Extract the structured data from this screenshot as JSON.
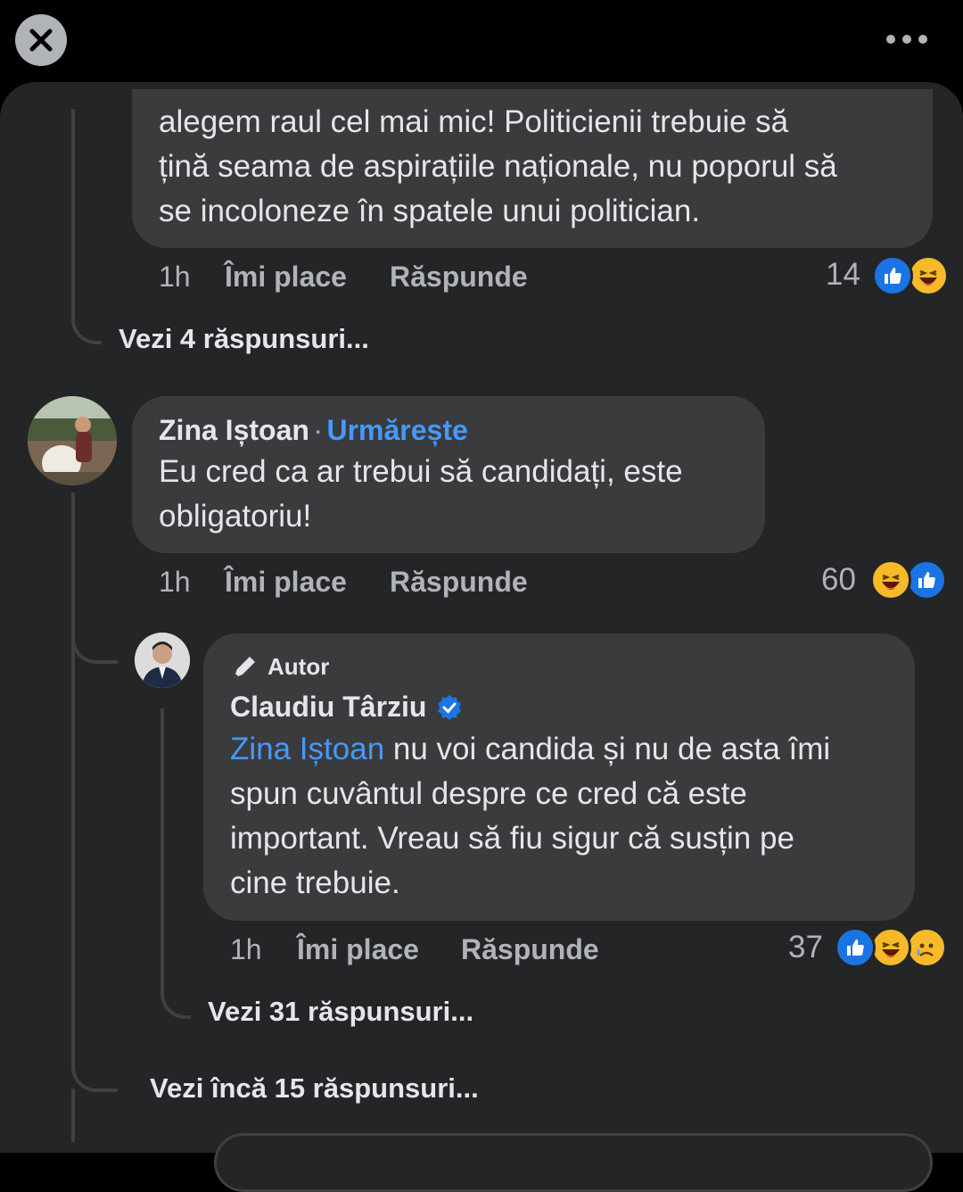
{
  "comment1": {
    "text_lines": [
      "alegem raul cel mai mic! Politicienii trebuie să",
      "țină seama de aspirațiile naționale, nu poporul să",
      "se incoloneze în spatele unui politician."
    ],
    "time": "1h",
    "like_label": "Îmi place",
    "reply_label": "Răspunde",
    "reaction_count": "14",
    "view_replies": "Vezi 4 răspunsuri..."
  },
  "comment2": {
    "author": "Zina Iștoan",
    "separator": "·",
    "follow_label": "Urmărește",
    "text_lines": [
      "Eu cred ca ar trebui să candidați, este",
      "obligatoriu!"
    ],
    "time": "1h",
    "like_label": "Îmi place",
    "reply_label": "Răspunde",
    "reaction_count": "60",
    "view_more_replies": "Vezi încă 15 răspunsuri..."
  },
  "reply1": {
    "badge": "Autor",
    "author": "Claudiu Târziu",
    "mention": "Zina Iștoan",
    "line1_rest": " nu voi candida și nu de asta îmi",
    "text_lines": [
      "spun cuvântul despre ce cred că este",
      "important. Vreau să fiu sigur că susțin pe",
      "cine trebuie."
    ],
    "time": "1h",
    "like_label": "Îmi place",
    "reply_label": "Răspunde",
    "reaction_count": "37",
    "view_replies": "Vezi 31 răspunsuri..."
  },
  "icons": {
    "close": "close-icon",
    "more": "more-horizontal-icon",
    "like": "like-reaction-icon",
    "haha": "haha-reaction-icon",
    "sad": "sad-reaction-icon",
    "verified": "verified-badge-icon",
    "author_badge": "pen-icon"
  },
  "colors": {
    "background": "#242526",
    "bubble": "#3a3b3c",
    "link_blue": "#4599ff",
    "like_blue": "#1b74e4",
    "emoji_yellow": "#f7b928"
  }
}
